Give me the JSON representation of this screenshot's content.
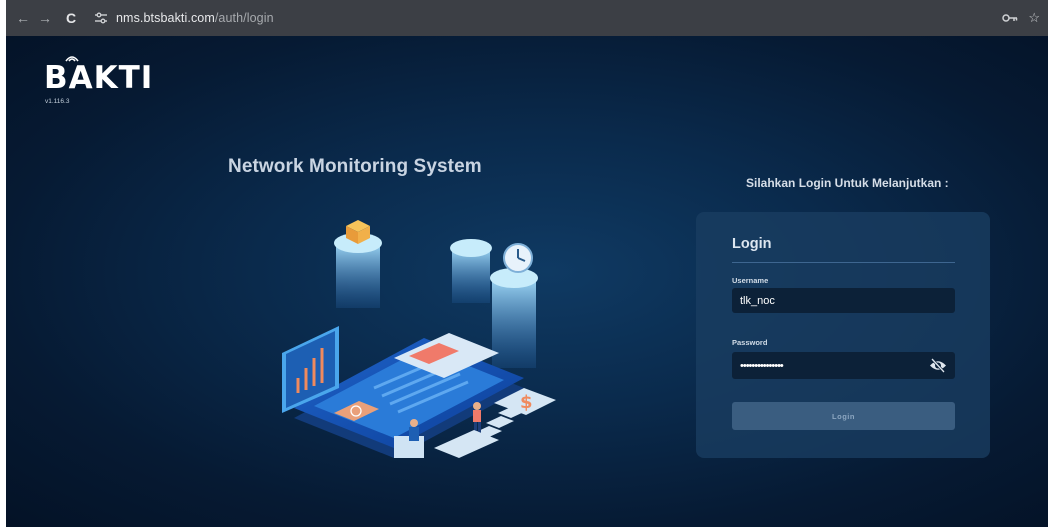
{
  "browser": {
    "url_host": "nms.btsbakti.com",
    "url_path": "/auth/login",
    "icons": [
      "back-arrow-icon",
      "forward-arrow-icon",
      "reload-icon",
      "site-settings-icon",
      "password-key-icon",
      "bookmark-star-icon"
    ]
  },
  "brand": {
    "logo": "BAKTI",
    "version": "v1.116.3"
  },
  "hero": {
    "title": "Network Monitoring System"
  },
  "login": {
    "prompt": "Silahkan Login Untuk Melanjutkan :",
    "card_title": "Login",
    "username_label": "Username",
    "username_value": "tlk_noc",
    "password_label": "Password",
    "password_value": "•••••••••••••••",
    "submit_label": "Login",
    "toggle_icon": "eye-off-icon"
  },
  "colors": {
    "background": "#0a2a4c",
    "card": "#1a3e62",
    "input": "#0c2138",
    "button": "#3a5d80"
  }
}
